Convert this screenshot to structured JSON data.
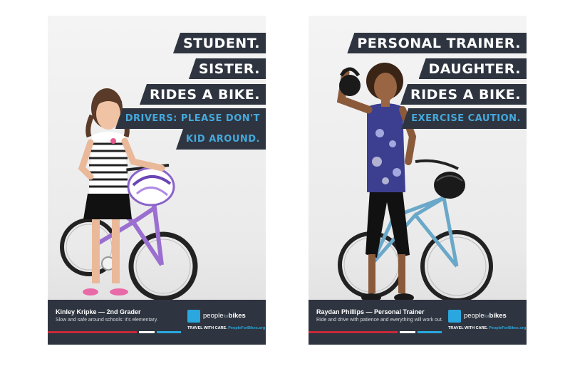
{
  "posters": [
    {
      "headlines": [
        "STUDENT.",
        "SISTER.",
        "RIDES A BIKE."
      ],
      "warnings": [
        "DRIVERS: PLEASE DON'T",
        "KID AROUND."
      ],
      "person_name": "Kinley Kripke — 2nd Grader",
      "person_note": "Slow and safe around schools: it's elementary."
    },
    {
      "headlines": [
        "PERSONAL TRAINER.",
        "DAUGHTER.",
        "RIDES A BIKE."
      ],
      "warnings": [
        "EXERCISE CAUTION."
      ],
      "person_name": "Raydan Phillips — Personal Trainer",
      "person_note": "Ride and drive with patience and everything will work out."
    }
  ],
  "brand": {
    "name_regular": "people",
    "name_small": "for",
    "name_bold": "bikes",
    "tagline": "TRAVEL WITH CARE.",
    "url": "PeopleForBikes.org"
  },
  "colors": {
    "panel": "#2f3540",
    "accent_blue": "#45a8dc",
    "stripe_red": "#c8293a",
    "stripe_blue": "#2aa7de"
  }
}
